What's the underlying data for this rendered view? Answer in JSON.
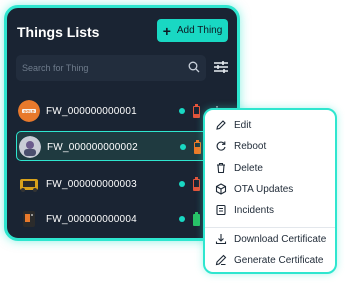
{
  "panel": {
    "title": "Things Lists",
    "add_button_label": "Add Thing",
    "search_placeholder": "Search for Thing"
  },
  "things": [
    {
      "name": "FW_000000000001",
      "status": "online",
      "battery_level": 0.35,
      "battery_color": "#e4533a"
    },
    {
      "name": "FW_000000000002",
      "status": "online",
      "battery_level": 0.6,
      "battery_color": "#f07a26",
      "selected": true
    },
    {
      "name": "FW_000000000003",
      "status": "online",
      "battery_level": 0.35,
      "battery_color": "#e4533a"
    },
    {
      "name": "FW_000000000004",
      "status": "online",
      "battery_level": 1.0,
      "battery_color": "#28c266"
    }
  ],
  "menu": {
    "items": [
      {
        "label": "Edit",
        "icon": "pencil-icon"
      },
      {
        "label": "Reboot",
        "icon": "refresh-icon"
      },
      {
        "label": "Delete",
        "icon": "trash-icon"
      },
      {
        "label": "OTA Updates",
        "icon": "box-icon"
      },
      {
        "label": "Incidents",
        "icon": "document-icon"
      },
      {
        "label": "Download Certificate",
        "icon": "download-icon"
      },
      {
        "label": "Generate Certificate",
        "icon": "pen-icon"
      }
    ]
  },
  "colors": {
    "accent": "#2ee6cf",
    "panel": "#1a2433",
    "online": "#19d8c3"
  }
}
